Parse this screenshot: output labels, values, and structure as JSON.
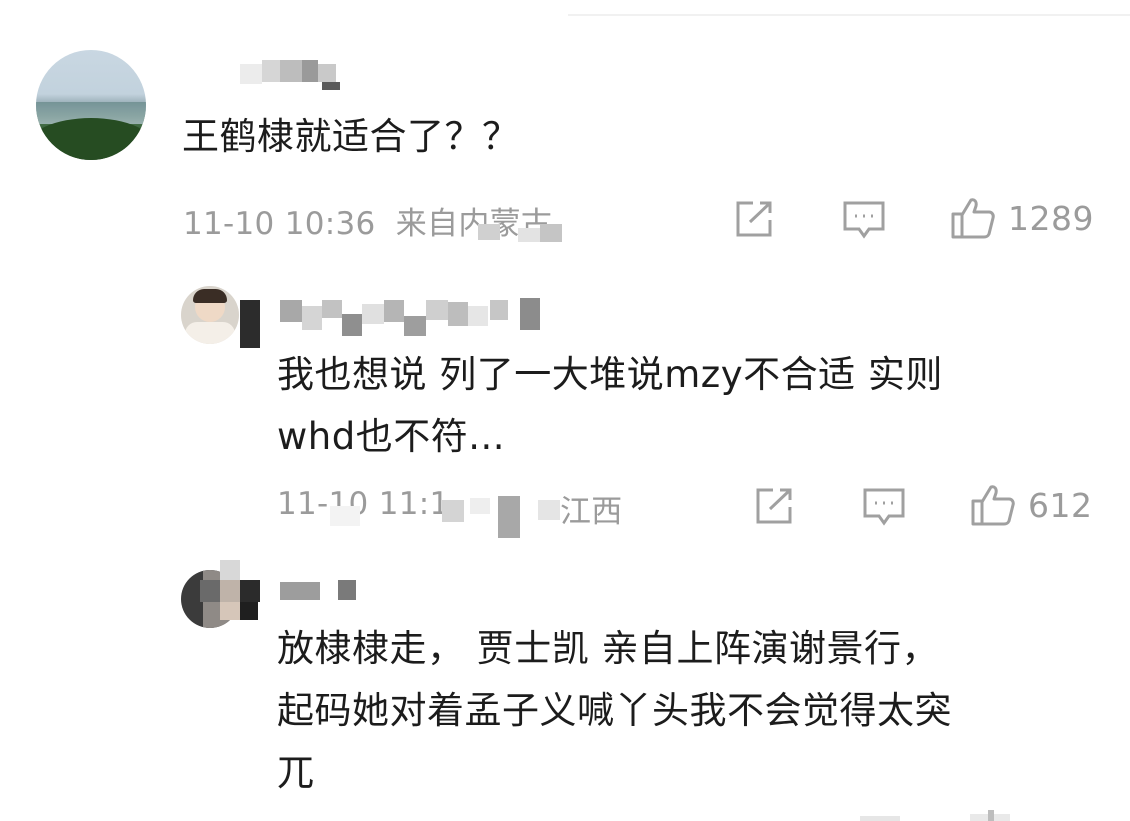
{
  "comments": [
    {
      "text": "王鹤棣就适合了？？",
      "time": "11-10 10:36",
      "location": "来自内蒙古",
      "likes": "1289",
      "avatar_icon": "landscape-avatar"
    },
    {
      "text_line1": "我也想说 列了一大堆说mzy不合适 实则",
      "text_line2": "whd也不符...",
      "time": "11-10 11:1",
      "location": "江西",
      "likes": "612",
      "avatar_icon": "person-avatar"
    },
    {
      "text_line1": "放棣棣走， 贾士凯  亲自上阵演谢景行，",
      "text_line2": "起码她对着孟子义喊丫头我不会觉得太突",
      "text_line3": "兀",
      "avatar_icon": "person-avatar"
    }
  ],
  "icons": {
    "share": "share-icon",
    "reply": "comment-icon",
    "like": "thumbs-up-icon"
  },
  "colors": {
    "text": "#1c1c1c",
    "meta": "#9b9b9b",
    "icon": "#a0a0a0"
  }
}
